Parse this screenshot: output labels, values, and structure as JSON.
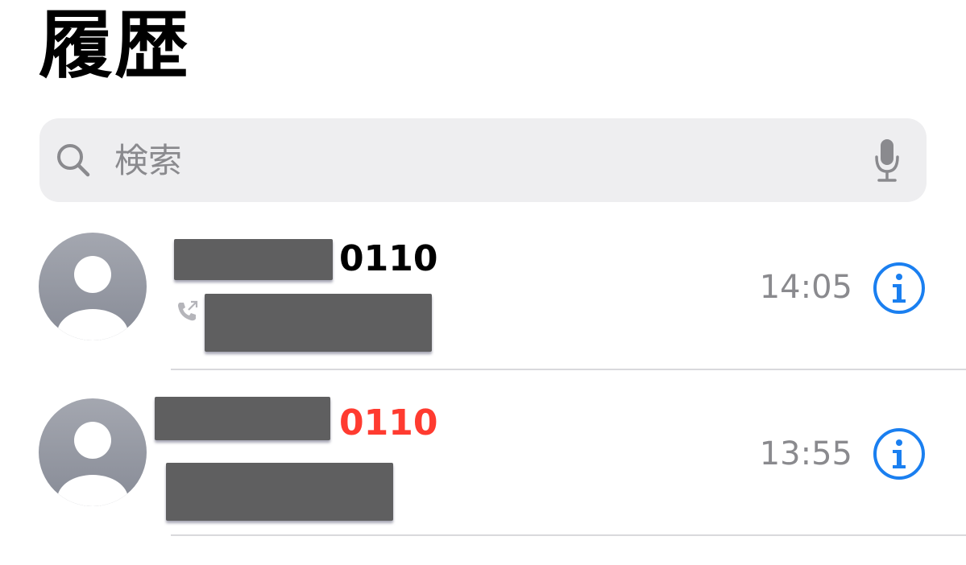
{
  "header": {
    "title": "履歴"
  },
  "search": {
    "placeholder": "検索"
  },
  "calls": [
    {
      "number_suffix": "0110",
      "time": "14:05",
      "missed": false,
      "outgoing": true
    },
    {
      "number_suffix": "0110",
      "time": "13:55",
      "missed": true,
      "outgoing": false
    }
  ],
  "colors": {
    "accent": "#1a7ff0",
    "missed": "#ff3b30",
    "secondary_text": "#8a8a8e",
    "search_bg": "#eeeef0",
    "avatar_top": "#a4a7b0",
    "avatar_bottom": "#878b96"
  },
  "icons": {
    "search": "search-icon",
    "mic": "microphone-icon",
    "avatar": "person-avatar",
    "outgoing": "outgoing-call-icon",
    "info": "info-icon"
  }
}
